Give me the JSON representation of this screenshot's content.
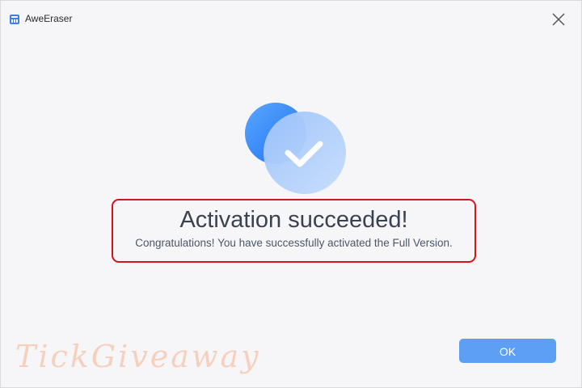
{
  "window": {
    "title": "AweEraser",
    "app_icon": "app-icon",
    "close_icon": "close-icon"
  },
  "dialog": {
    "headline": "Activation succeeded!",
    "message": "Congratulations! You have successfully activated the Full Version.",
    "success_icon": "checkmark-icon",
    "ok_label": "OK"
  },
  "overlay": {
    "watermark_text": "TickGiveaway"
  },
  "colors": {
    "accent": "#5e9ff6",
    "highlight_border": "#d4141c",
    "background": "#f6f6f9",
    "text": "#3a4150"
  }
}
